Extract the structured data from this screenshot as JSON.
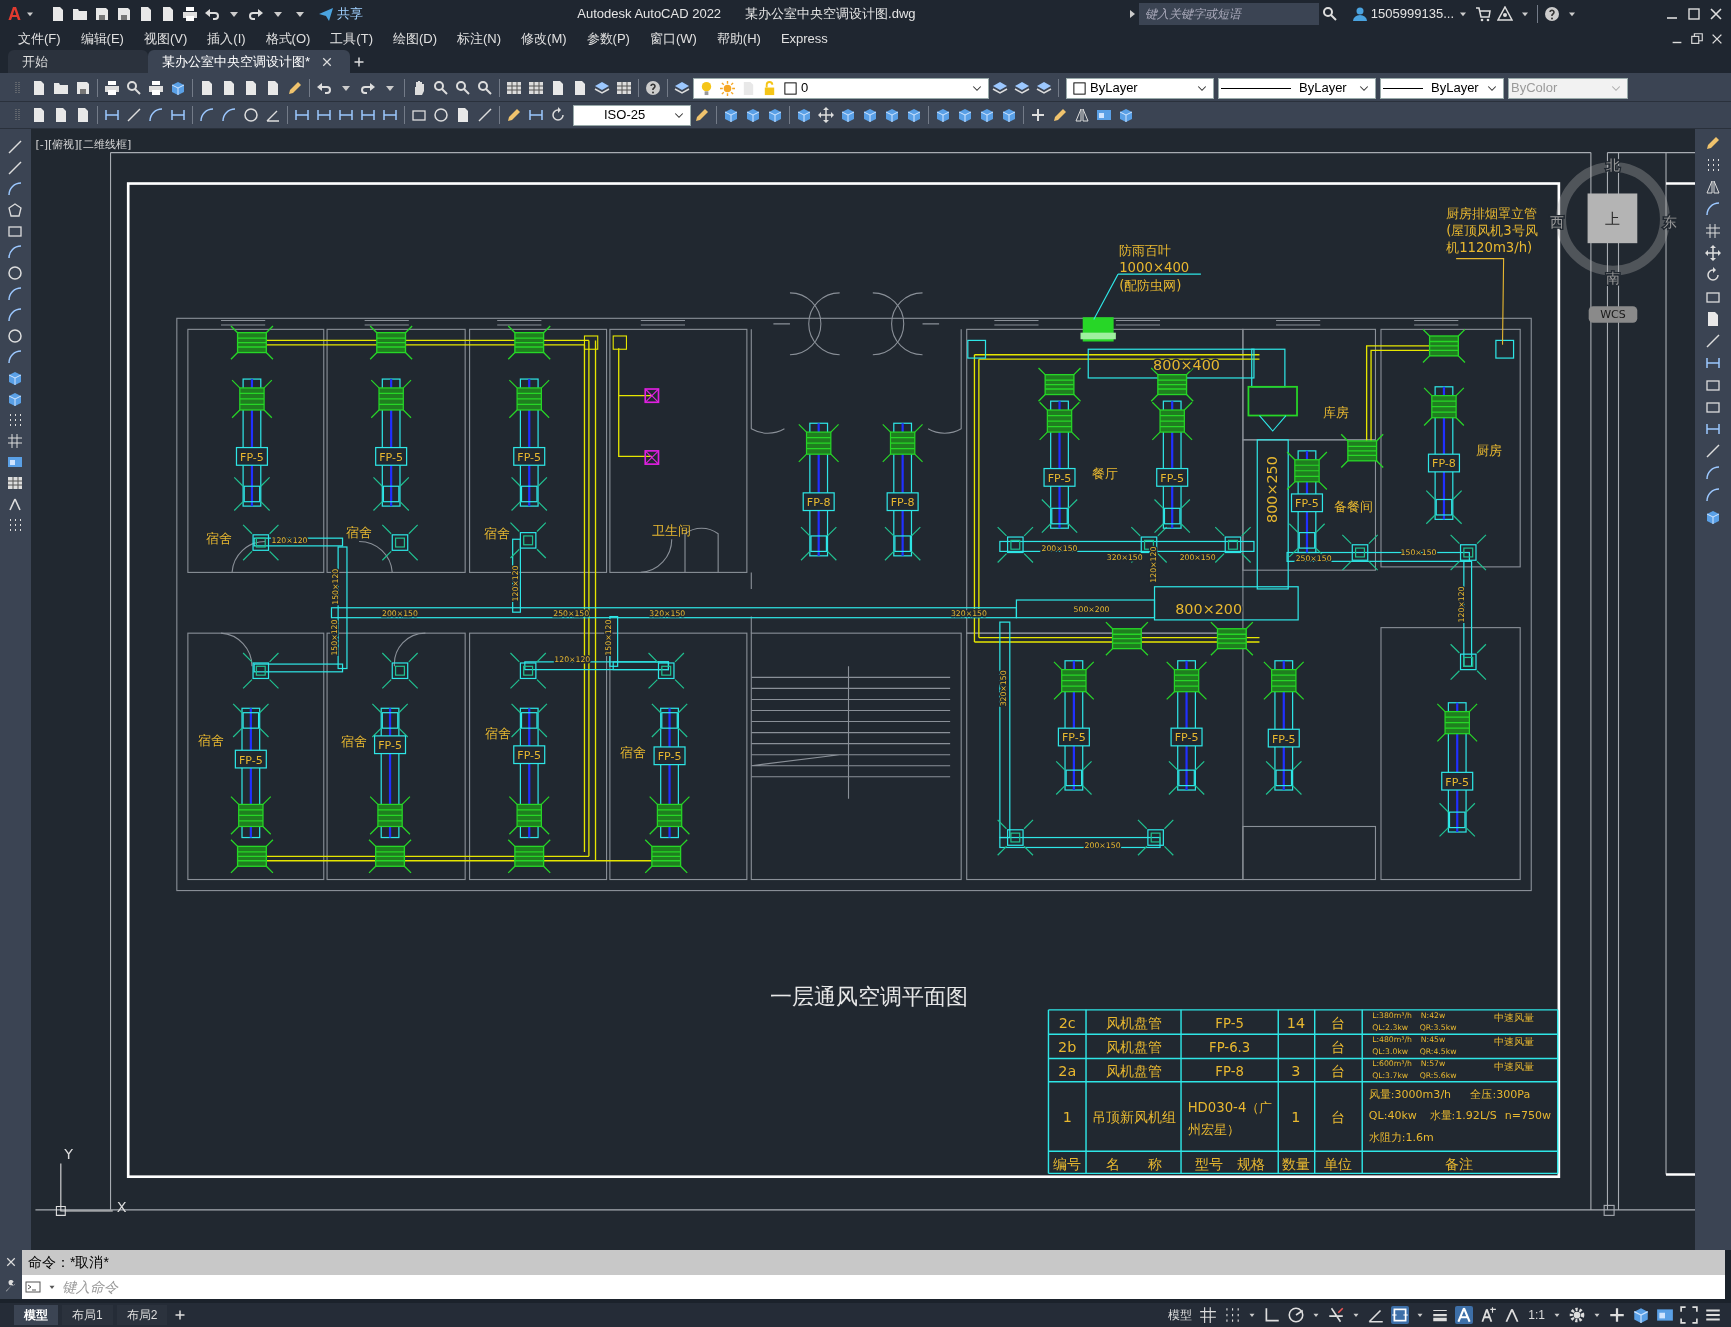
{
  "app": {
    "logo": "A",
    "share": "共享",
    "title": "Autodesk AutoCAD 2022",
    "file": "某办公室中央空调设计图.dwg",
    "search": {
      "placeholder": "键入关键字或短语"
    },
    "user": "1505999135..."
  },
  "menu": [
    "文件(F)",
    "编辑(E)",
    "视图(V)",
    "插入(I)",
    "格式(O)",
    "工具(T)",
    "绘图(D)",
    "标注(N)",
    "修改(M)",
    "参数(P)",
    "窗口(W)",
    "帮助(H)",
    "Express"
  ],
  "doc_tabs": [
    {
      "label": "开始",
      "selected": false
    },
    {
      "label": "某办公室中央空调设计图*",
      "selected": true
    }
  ],
  "properties": {
    "layer": "0",
    "color_setting": "ByLayer",
    "linetype": "ByLayer",
    "lineweight": "ByLayer",
    "plot_style": {
      "value": "ByColor",
      "disabled": true
    },
    "dim_style": "ISO-25"
  },
  "viewport": {
    "label": "[-][俯视][二维线框]"
  },
  "viewcube": {
    "north": "北",
    "south": "南",
    "west": "西",
    "east": "东",
    "face": "上",
    "ucs": "WCS"
  },
  "drawing": {
    "title": "一层通风空调平面图",
    "rooms": [
      "宿舍",
      "宿舍",
      "宿舍",
      "卫生间",
      "餐厅",
      "库房",
      "厨房",
      "备餐间",
      "宿舍",
      "宿舍",
      "宿舍",
      "宿舍"
    ],
    "units": [
      "FP-5",
      "FP-5",
      "FP-5",
      "FP-8",
      "FP-8",
      "FP-5",
      "FP-5",
      "FP-5",
      "FP-8",
      "FP-5",
      "FP-5",
      "FP-5",
      "FP-5",
      "FP-5",
      "FP-5",
      "FP-5",
      "FP-5"
    ],
    "duct_sizes": [
      {
        "text": "120×120",
        "kind": "branch"
      },
      {
        "text": "150×120",
        "kind": "branch"
      },
      {
        "text": "200×150",
        "kind": "branch"
      },
      {
        "text": "150×120",
        "kind": "branch"
      },
      {
        "text": "120×120",
        "kind": "branch"
      },
      {
        "text": "250×150",
        "kind": "branch"
      },
      {
        "text": "150×120",
        "kind": "branch"
      },
      {
        "text": "320×150",
        "kind": "branch"
      },
      {
        "text": "120×120",
        "kind": "branch"
      },
      {
        "text": "320×150",
        "kind": "branch"
      },
      {
        "text": "320×150",
        "kind": "branch"
      },
      {
        "text": "200×150",
        "kind": "branch"
      },
      {
        "text": "320×150",
        "kind": "branch"
      },
      {
        "text": "120×120",
        "kind": "branch"
      },
      {
        "text": "200×150",
        "kind": "branch"
      },
      {
        "text": "250×150",
        "kind": "branch"
      },
      {
        "text": "150×150",
        "kind": "branch"
      },
      {
        "text": "120×120",
        "kind": "branch"
      },
      {
        "text": "500×200",
        "kind": "branch"
      },
      {
        "text": "200×150",
        "kind": "branch"
      },
      {
        "text": "800×400",
        "kind": "main"
      },
      {
        "text": "800×200",
        "kind": "main"
      },
      {
        "text": "800×250",
        "kind": "main"
      }
    ],
    "notes": [
      {
        "lines": [
          "防雨百叶",
          "1000×400",
          "(配防虫网)"
        ]
      },
      {
        "lines": [
          "厨房排烟罩立管",
          "(屋顶风机3号风",
          "机1120m3/h)"
        ]
      }
    ]
  },
  "schedule": {
    "rows": [
      {
        "no": "2c",
        "name": "风机盘管",
        "model_lines": [
          "FP-5"
        ],
        "qty": "14",
        "unit": "台",
        "remarks": [
          "L:380m³/h",
          "N:42w",
          "中速风量",
          "QL:2.3kw",
          "QR:3.5kw"
        ]
      },
      {
        "no": "2b",
        "name": "风机盘管",
        "model_lines": [
          "FP-6.3"
        ],
        "unit": "台",
        "remarks": [
          "L:480m³/h",
          "N:45w",
          "中速风量",
          "QL:3.0kw",
          "QR:4.5kw"
        ]
      },
      {
        "no": "2a",
        "name": "风机盘管",
        "model_lines": [
          "FP-8"
        ],
        "qty": "3",
        "unit": "台",
        "remarks": [
          "L:600m³/h",
          "N:57w",
          "中速风量",
          "QL:3.7kw",
          "QR:5.6kw"
        ]
      },
      {
        "no": "1",
        "name": "吊顶新风机组",
        "model_lines": [
          "HD030-4（广",
          "州宏星）"
        ],
        "qty": "1",
        "unit": "台",
        "remarks": [
          "风量:3000m3/h",
          "全压:300Pa",
          "QL:40kw",
          "水量:1.92L/S",
          "n=750w",
          "水阻力:1.6m"
        ]
      }
    ],
    "header": [
      "编号",
      "名　　称",
      "型号　规格",
      "数量",
      "单位",
      "备注"
    ]
  },
  "ucs": {
    "y": "Y",
    "x": "X"
  },
  "command": {
    "history": "命令：*取消*",
    "placeholder": "键入命令"
  },
  "layout_tabs": [
    {
      "label": "模型",
      "selected": true
    },
    {
      "label": "布局1",
      "selected": false
    },
    {
      "label": "布局2",
      "selected": false
    }
  ],
  "status": {
    "space": "模型",
    "scale": "1:1",
    "toggles": [
      {
        "kind": "grid",
        "on": false
      },
      {
        "kind": "dots",
        "on": false
      },
      {
        "kind": "ortho",
        "on": false
      },
      {
        "kind": "polar",
        "on": false
      },
      {
        "kind": "track",
        "on": false
      },
      {
        "kind": "angle",
        "on": false
      },
      {
        "kind": "osnap",
        "on": true
      },
      {
        "kind": "lw",
        "on": false
      },
      {
        "kind": "annot",
        "on": true
      },
      {
        "kind": "annot2",
        "on": false
      },
      {
        "kind": "annot3",
        "on": false
      }
    ]
  }
}
